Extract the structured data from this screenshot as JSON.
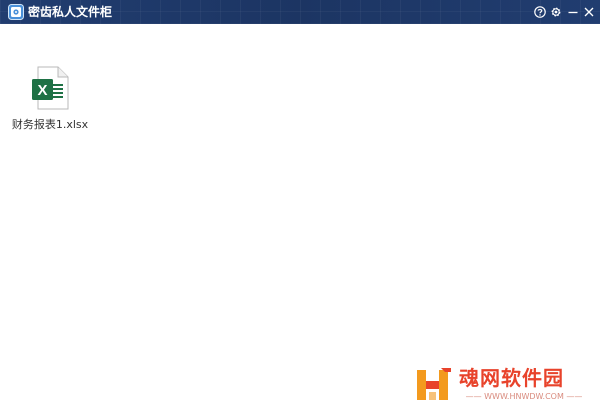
{
  "window": {
    "title": "密齿私人文件柜"
  },
  "titlebar": {
    "controls": [
      {
        "name": "help",
        "icon": "help-circle-icon"
      },
      {
        "name": "settings",
        "icon": "gear-icon"
      },
      {
        "name": "minimize",
        "icon": "minimize-icon"
      },
      {
        "name": "close",
        "icon": "close-icon"
      }
    ]
  },
  "files": [
    {
      "name": "财务报表1.xlsx",
      "icon": "excel-file-icon",
      "icon_letter": "X"
    }
  ],
  "watermark": {
    "title": "魂网软件园",
    "url": "—— WWW.HNWDW.COM ——"
  },
  "colors": {
    "titlebar_bg": "#1f3a6a",
    "excel_green": "#1e7145",
    "watermark_red": "#e8432b",
    "watermark_orange": "#f39a1e"
  }
}
